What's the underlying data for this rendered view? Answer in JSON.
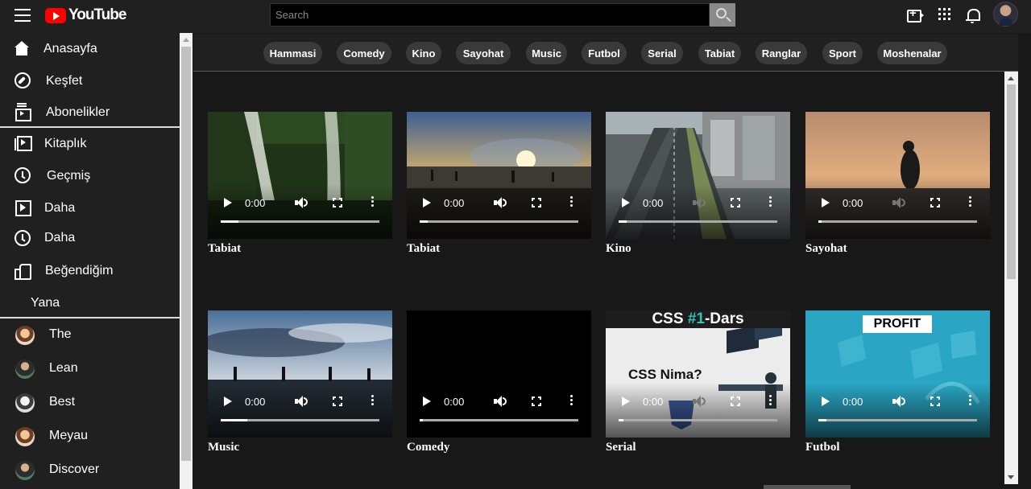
{
  "header": {
    "logo_text": "YouTube",
    "search_placeholder": "Search",
    "icons": [
      "menu-icon",
      "search-icon",
      "create-video-icon",
      "apps-grid-icon",
      "bell-icon"
    ]
  },
  "sidebar": {
    "items": [
      {
        "label": "Anasayfa",
        "icon": "home-icon"
      },
      {
        "label": "Keşfet",
        "icon": "compass-icon"
      },
      {
        "label": "Abonelikler",
        "icon": "subscriptions-icon"
      },
      {
        "label": "Kitaplık",
        "icon": "library-icon"
      },
      {
        "label": "Geçmiş",
        "icon": "history-icon"
      },
      {
        "label": "Daha",
        "icon": "play-square-icon"
      },
      {
        "label": "Daha",
        "icon": "clock-icon"
      },
      {
        "label": "Beğendiğim",
        "icon": "thumbs-up-icon"
      }
    ],
    "section_label": "Yana",
    "channels": [
      {
        "label": "The"
      },
      {
        "label": "Lean"
      },
      {
        "label": "Best"
      },
      {
        "label": "Meyau"
      },
      {
        "label": "Discover"
      }
    ]
  },
  "chips": [
    "Hammasi",
    "Comedy",
    "Kino",
    "Sayohat",
    "Music",
    "Futbol",
    "Serial",
    "Tabiat",
    "Ranglar",
    "Sport",
    "Moshenalar"
  ],
  "videos": [
    {
      "caption": "Tabiat",
      "time": "0:00",
      "scene": "waterfall",
      "progress": 0.11
    },
    {
      "caption": "Tabiat",
      "time": "0:00",
      "scene": "beach-sunset",
      "progress": 0.05
    },
    {
      "caption": "Kino",
      "time": "0:00",
      "scene": "city-highway",
      "progress": 0.05
    },
    {
      "caption": "Sayohat",
      "time": "0:00",
      "scene": "penguin-shore",
      "progress": 0.02
    },
    {
      "caption": "Music",
      "time": "0:00",
      "scene": "sea-clouds",
      "progress": 0.17
    },
    {
      "caption": "Comedy",
      "time": "0:00",
      "scene": "black",
      "progress": 0.02
    },
    {
      "caption": "Serial",
      "time": "0:00",
      "scene": "css-lesson",
      "progress": 0.03
    },
    {
      "caption": "Futbol",
      "time": "0:00",
      "scene": "profit",
      "progress": 0.05
    }
  ],
  "thumbnail_text": {
    "css_title_a": "CSS ",
    "css_title_hl": "#1",
    "css_title_b": "-Dars",
    "css_question": "CSS Nima?",
    "profit_label": "PROFIT"
  }
}
